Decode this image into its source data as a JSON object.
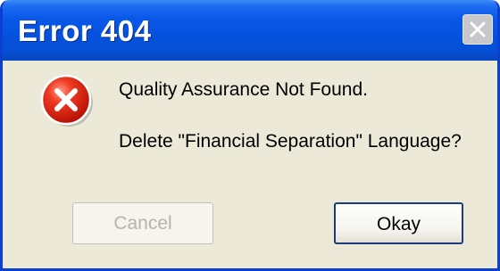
{
  "window": {
    "title": "Error 404"
  },
  "icons": {
    "close": "close-icon",
    "error": "error-icon"
  },
  "message": {
    "line1": "Quality Assurance Not Found.",
    "line2": "Delete \"Financial Separation\" Language?"
  },
  "buttons": {
    "cancel_label": "Cancel",
    "cancel_enabled": false,
    "okay_label": "Okay"
  },
  "colors": {
    "titlebar": "#0652e0",
    "dialog_bg": "#ece9d8",
    "error_red": "#e02010"
  }
}
